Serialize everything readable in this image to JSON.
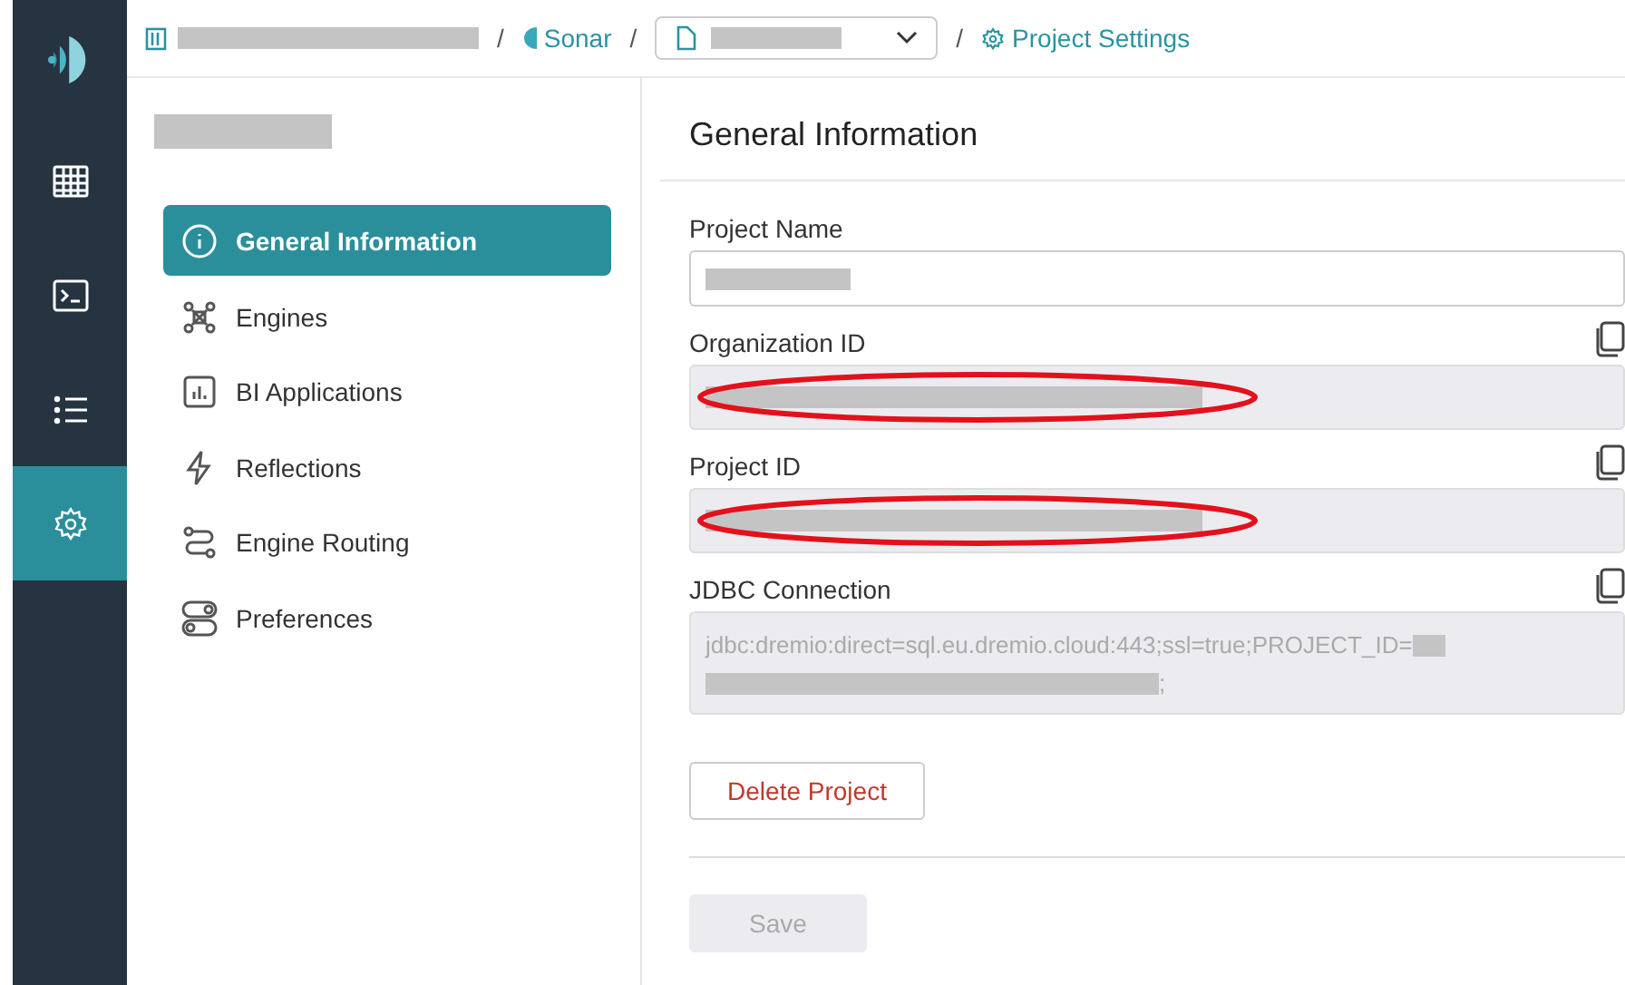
{
  "rail": {
    "items": [
      {
        "selected": false
      },
      {
        "selected": false
      },
      {
        "selected": false
      },
      {
        "selected": true
      }
    ]
  },
  "breadcrumb": {
    "separators": [
      "/",
      "/",
      "/"
    ],
    "space": "Sonar",
    "page": "Project Settings"
  },
  "nav": {
    "items": [
      {
        "label": "General Information",
        "selected": true
      },
      {
        "label": "Engines",
        "selected": false
      },
      {
        "label": "BI Applications",
        "selected": false
      },
      {
        "label": "Reflections",
        "selected": false
      },
      {
        "label": "Engine Routing",
        "selected": false
      },
      {
        "label": "Preferences",
        "selected": false
      }
    ]
  },
  "section_title": "General Information",
  "fields": [
    {
      "label": "Project Name",
      "kind": "editable",
      "copyable": false,
      "highlighted": false
    },
    {
      "label": "Organization ID",
      "kind": "readonly",
      "copyable": true,
      "highlighted": true
    },
    {
      "label": "Project ID",
      "kind": "readonly",
      "copyable": true,
      "highlighted": true
    },
    {
      "label": "JDBC Connection",
      "kind": "readonly",
      "copyable": true,
      "highlighted": false,
      "value": "jdbc:dremio:direct=sql.eu.dremio.cloud:443;ssl=true;PROJECT_ID=",
      "value_end": ";"
    }
  ],
  "delete_button": "Delete Project",
  "save_button": {
    "label": "Save",
    "disabled": true
  }
}
